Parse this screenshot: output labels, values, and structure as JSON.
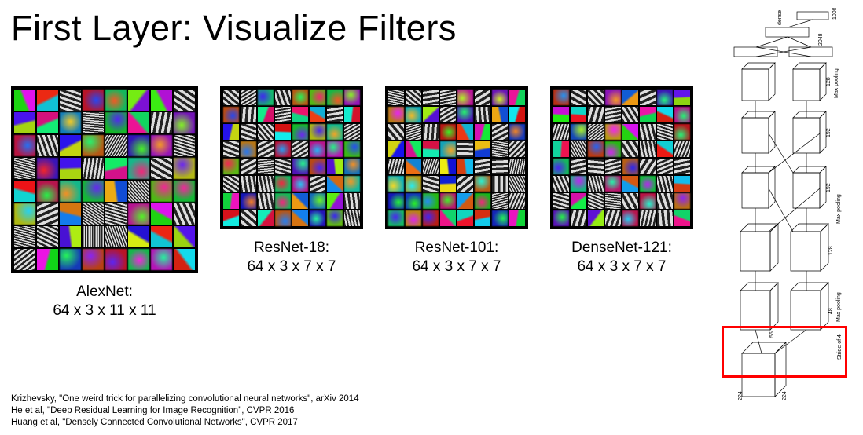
{
  "title": "First Layer: Visualize Filters",
  "networks": [
    {
      "name": "AlexNet:",
      "shape": "64 x 3 x 11 x 11",
      "grid": "alex"
    },
    {
      "name": "ResNet-18:",
      "shape": "64 x 3 x 7 x 7",
      "grid": "g7"
    },
    {
      "name": "ResNet-101:",
      "shape": "64 x 3 x 7 x 7",
      "grid": "g7"
    },
    {
      "name": "DenseNet-121:",
      "shape": "64 x 3 x 7 x 7",
      "grid": "g7"
    }
  ],
  "references": [
    "Krizhevsky, \"One weird trick for parallelizing convolutional neural networks\", arXiv 2014",
    "He et al, \"Deep Residual Learning for Image Recognition\", CVPR 2016",
    "Huang et al, \"Densely Connected Convolutional Networks\", CVPR 2017"
  ],
  "arch_labels": {
    "dense": "dense",
    "maxpool": "Max pooling",
    "stride": "Stride of 4",
    "n2048": "2048",
    "n1000": "1000",
    "n192": "192",
    "n128": "128",
    "n48": "48",
    "n55": "55",
    "n224": "224"
  }
}
